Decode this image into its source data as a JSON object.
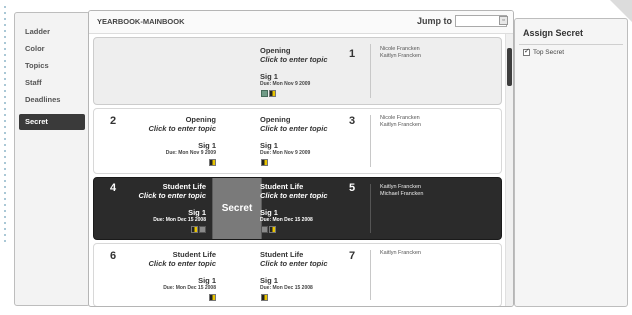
{
  "sidebar": {
    "items": [
      {
        "label": "Ladder"
      },
      {
        "label": "Color"
      },
      {
        "label": "Topics"
      },
      {
        "label": "Staff"
      },
      {
        "label": "Deadlines"
      },
      {
        "label": "Secret",
        "active": true
      }
    ]
  },
  "header": {
    "book_title": "YEARBOOK-MAINBOOK",
    "jump_label": "Jump to",
    "jump_value": ""
  },
  "spreads": [
    {
      "left": null,
      "right": {
        "number": "1",
        "section": "Opening",
        "topic": "Click to enter topic",
        "sig": "Sig 1",
        "due": "Due: Mon Nov 9 2009"
      },
      "names": [
        "Nicole Francken",
        "Kaitlyn Francken"
      ]
    },
    {
      "left": {
        "number": "2",
        "section": "Opening",
        "topic": "Click to enter topic",
        "sig": "Sig 1",
        "due": "Due: Mon Nov 9 2009"
      },
      "right": {
        "number": "3",
        "section": "Opening",
        "topic": "Click to enter topic",
        "sig": "Sig 1",
        "due": "Due: Mon Nov 9 2009"
      },
      "names": [
        "Nicole Francken",
        "Kaitlyn Francken"
      ]
    },
    {
      "left": {
        "number": "4",
        "section": "Student Life",
        "topic": "Click to enter topic",
        "sig": "Sig 1",
        "due": "Due: Mon Dec 15 2008"
      },
      "right": {
        "number": "5",
        "section": "Student Life",
        "topic": "Click to enter topic",
        "sig": "Sig 1",
        "due": "Due: Mon Dec 15 2008"
      },
      "names": [
        "Kaitlyn Francken",
        "Michael Francken"
      ],
      "secret_label": "Secret"
    },
    {
      "left": {
        "number": "6",
        "section": "Student Life",
        "topic": "Click to enter topic",
        "sig": "Sig 1",
        "due": "Due: Mon Dec 15 2008"
      },
      "right": {
        "number": "7",
        "section": "Student Life",
        "topic": "Click to enter topic",
        "sig": "Sig 1",
        "due": "Due: Mon Dec 15 2008"
      },
      "names": [
        "Kaitlyn Francken"
      ]
    }
  ],
  "assign_panel": {
    "title": "Assign Secret",
    "checkbox_label": "Top Secret",
    "checked": true
  },
  "colors": {
    "active_nav": "#3a3a3a",
    "selected_spread": "#2b2b2b",
    "secret_overlay": "#7a7a7a"
  }
}
